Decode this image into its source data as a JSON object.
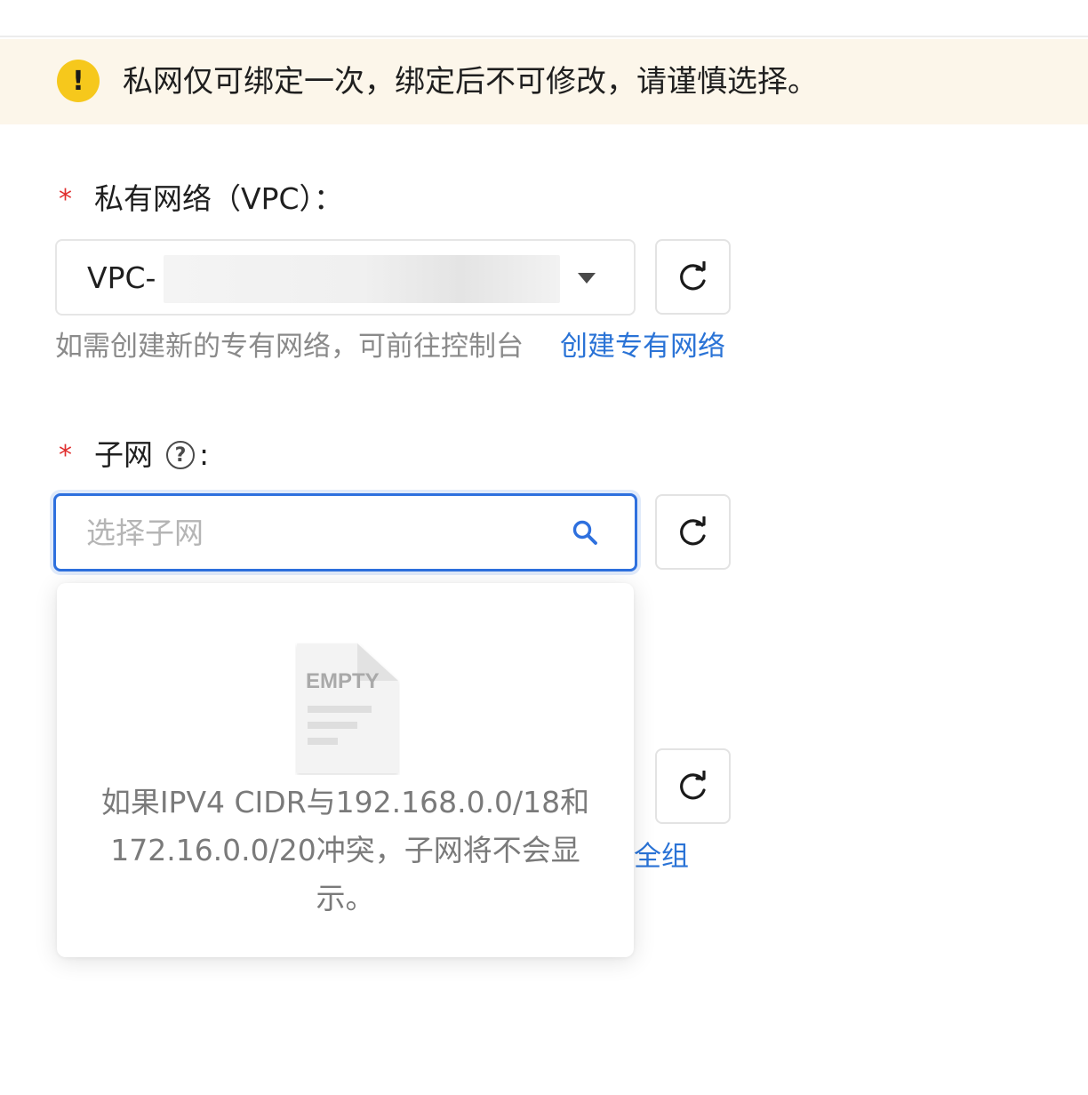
{
  "notice": {
    "icon": "warning-exclamation-icon",
    "icon_glyph": "!",
    "text": "私网仅可绑定一次，绑定后不可修改，请谨慎选择。"
  },
  "vpc": {
    "required_mark": "*",
    "label": "私有网络（VPC）：",
    "value": "VPC-",
    "hint": "如需创建新的专有网络，可前往控制台",
    "link": "创建专有网络"
  },
  "subnet": {
    "required_mark": "*",
    "label": "子网",
    "help_glyph": "?",
    "colon": ":",
    "placeholder": "选择子网",
    "empty_image_text": "EMPTY",
    "empty_message": "如果IPV4 CIDR与192.168.0.0/18和172.16.0.0/20冲突，子网将不会显示。"
  },
  "third_field": {
    "partial_link": "全组"
  },
  "colors": {
    "accent": "#2e70de",
    "link": "#2a73d6",
    "warning": "#f6c81c",
    "notice_bg": "#fcf6ea",
    "required": "#e02e2e"
  }
}
